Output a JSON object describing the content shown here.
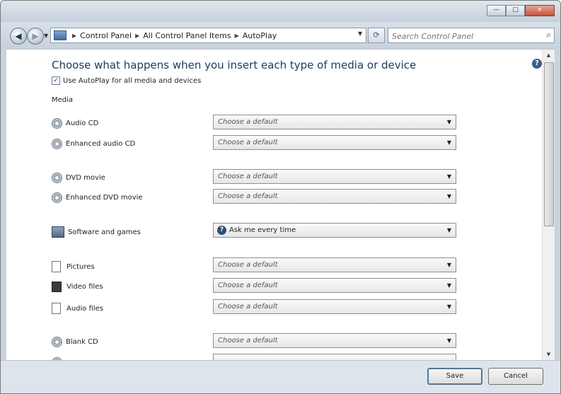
{
  "window": {
    "controls": {
      "minimize": "—",
      "maximize": "□",
      "close": "×"
    }
  },
  "nav": {
    "back_icon": "left-arrow",
    "breadcrumbs": [
      "Control Panel",
      "All Control Panel Items",
      "AutoPlay"
    ],
    "search_placeholder": "Search Control Panel"
  },
  "main": {
    "heading": "Choose what happens when you insert each type of media or device",
    "use_autoplay_label": "Use AutoPlay for all media and devices",
    "use_autoplay_checked": true,
    "section_media": "Media",
    "rows": [
      {
        "label": "Audio CD",
        "value": "Choose a default",
        "icon": "disc-icon"
      },
      {
        "label": "Enhanced audio CD",
        "value": "Choose a default",
        "icon": "disc-icon"
      },
      {
        "label": "DVD movie",
        "value": "Choose a default",
        "icon": "disc-icon"
      },
      {
        "label": "Enhanced DVD movie",
        "value": "Choose a default",
        "icon": "disc-icon"
      },
      {
        "label": "Software and games",
        "value": "Ask me every time",
        "icon": "software-icon"
      },
      {
        "label": "Pictures",
        "value": "Choose a default",
        "icon": "pictures-file-icon"
      },
      {
        "label": "Video files",
        "value": "Choose a default",
        "icon": "video-file-icon"
      },
      {
        "label": "Audio files",
        "value": "Choose a default",
        "icon": "audio-file-icon"
      },
      {
        "label": "Blank CD",
        "value": "Choose a default",
        "icon": "disc-icon"
      }
    ]
  },
  "footer": {
    "save": "Save",
    "cancel": "Cancel"
  }
}
